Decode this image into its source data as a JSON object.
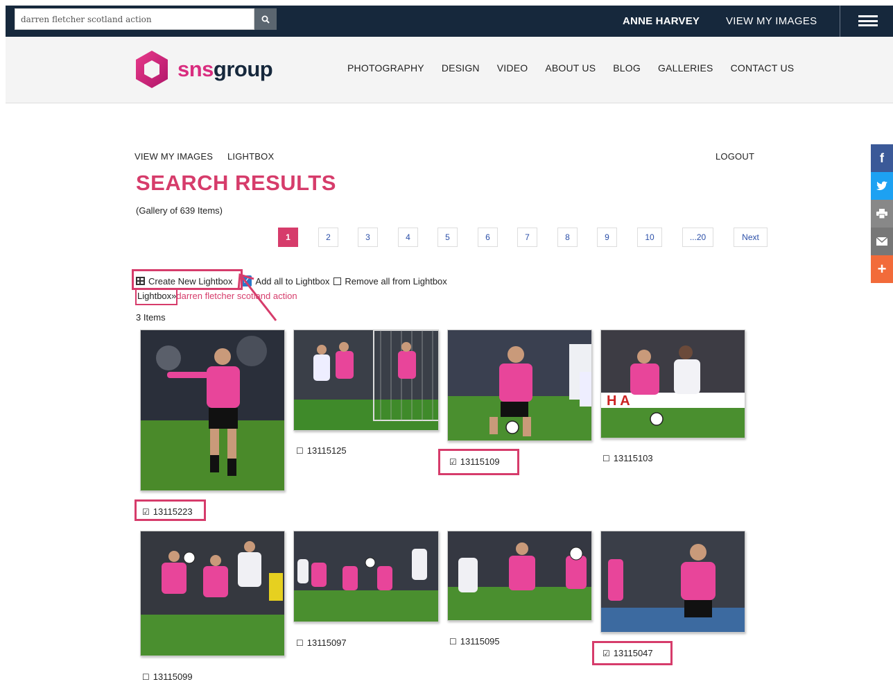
{
  "topbar": {
    "search_value": "darren fletcher scotland action",
    "search_button_icon": "search-icon",
    "user_name": "ANNE HARVEY",
    "view_my_images": "VIEW MY IMAGES",
    "menu_icon": "hamburger-icon"
  },
  "header": {
    "logo_sns": "sns",
    "logo_group": "group",
    "nav": [
      "PHOTOGRAPHY",
      "DESIGN",
      "VIDEO",
      "ABOUT US",
      "BLOG",
      "GALLERIES",
      "CONTACT US"
    ]
  },
  "subnav": {
    "view_my_images": "VIEW MY IMAGES",
    "lightbox": "LIGHTBOX",
    "logout": "LOGOUT"
  },
  "main": {
    "title": "SEARCH RESULTS",
    "gallery_count": "(Gallery of 639 Items)",
    "pages": [
      "1",
      "2",
      "3",
      "4",
      "5",
      "6",
      "7",
      "8",
      "9",
      "10",
      "...20",
      "Next"
    ],
    "active_page": "1",
    "create_lightbox": "Create New Lightbox",
    "add_all": "Add all to Lightbox",
    "remove_all": "Remove all from Lightbox",
    "crumb_label": "Lightbox»",
    "crumb_term": "darren fletcher scotland action",
    "items_count": "3 Items",
    "images": [
      {
        "id": "13115223",
        "checked": true
      },
      {
        "id": "13115125",
        "checked": false
      },
      {
        "id": "13115109",
        "checked": true
      },
      {
        "id": "13115103",
        "checked": false
      },
      {
        "id": "13115099",
        "checked": false
      },
      {
        "id": "13115097",
        "checked": false
      },
      {
        "id": "13115095",
        "checked": false
      },
      {
        "id": "13115047",
        "checked": true
      }
    ]
  },
  "colors": {
    "brand_pink": "#d63c6b",
    "topbar": "#16283c",
    "checkbox_blue": "#2a78c8"
  },
  "social": [
    "f",
    "t",
    "print",
    "mail",
    "+"
  ]
}
